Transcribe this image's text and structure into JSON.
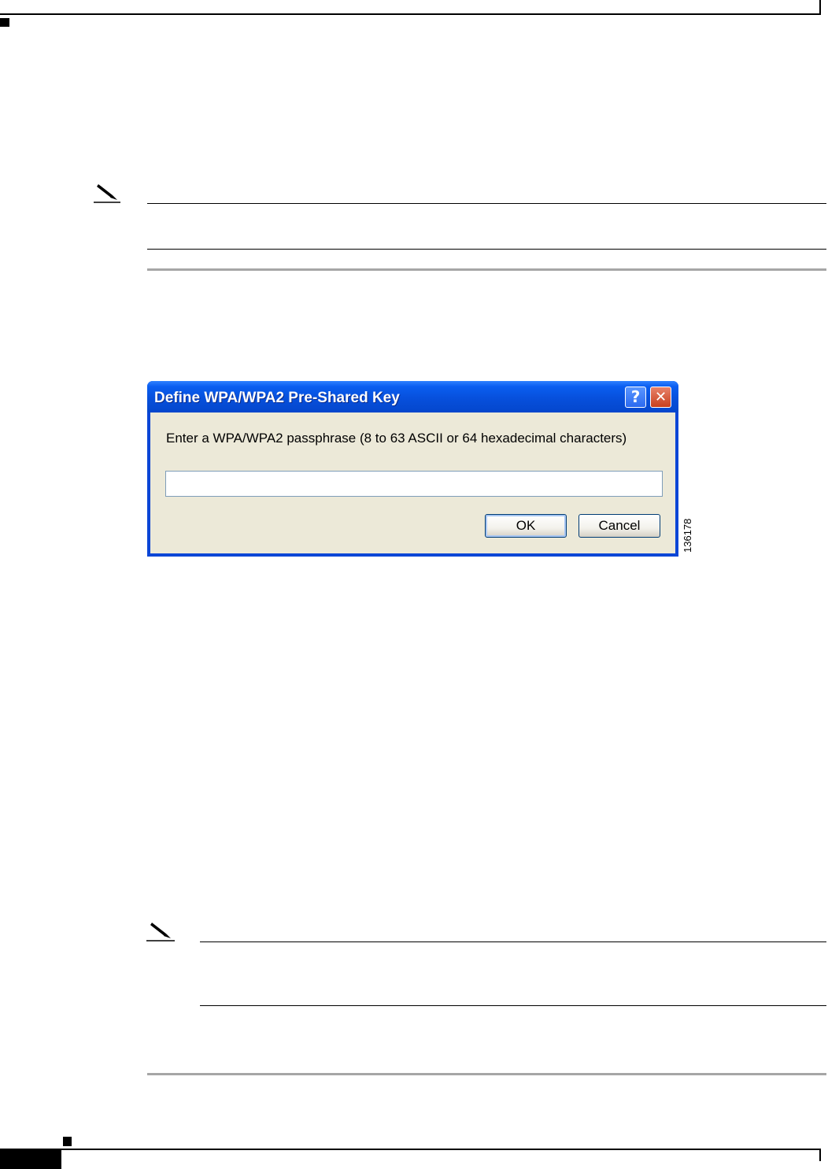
{
  "dialog": {
    "title": "Define WPA/WPA2 Pre-Shared Key",
    "help_glyph": "?",
    "close_glyph": "✕",
    "prompt": "Enter a WPA/WPA2 passphrase (8 to 63 ASCII or 64 hexadecimal characters)",
    "passphrase_value": "",
    "ok_label": "OK",
    "cancel_label": "Cancel"
  },
  "figure": {
    "id": "136178"
  },
  "icons": {
    "note_1": "pencil-note-icon",
    "note_2": "pencil-note-icon"
  },
  "colors": {
    "titlebar": "#0a5ef0",
    "dialog_body": "#ece9d8",
    "rule_gray": "#a6a6a6"
  }
}
